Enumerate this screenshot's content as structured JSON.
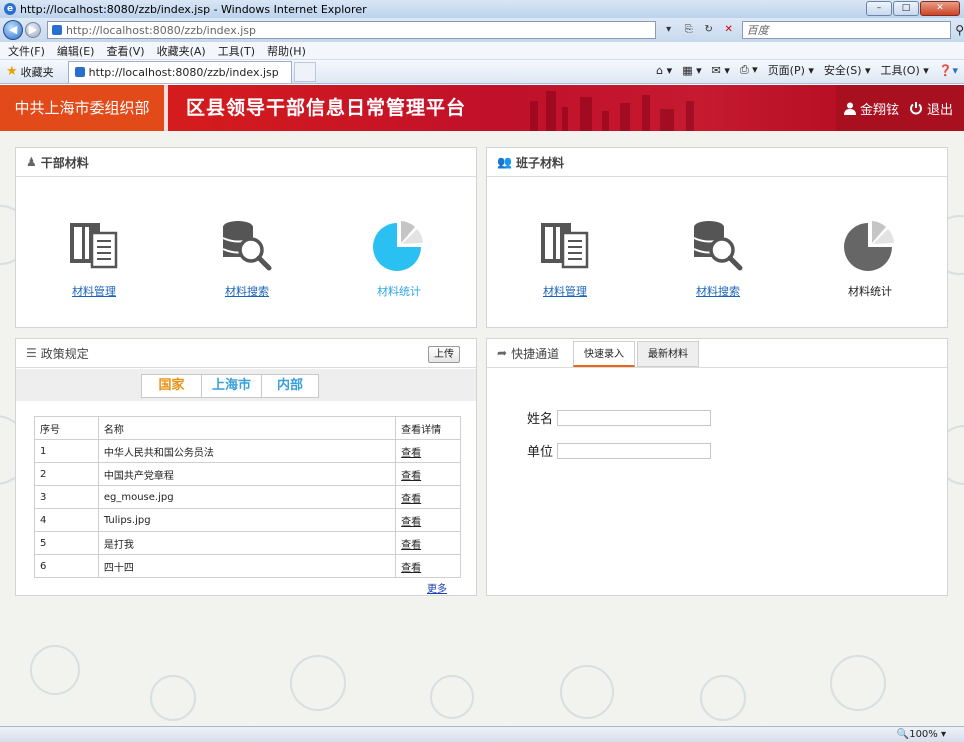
{
  "browser": {
    "window_title": "http://localhost:8080/zzb/index.jsp - Windows Internet Explorer",
    "address": "http://localhost:8080/zzb/index.jsp",
    "search_placeholder": "百度",
    "menu": [
      "文件(F)",
      "编辑(E)",
      "查看(V)",
      "收藏夹(A)",
      "工具(T)",
      "帮助(H)"
    ],
    "favorites_label": "收藏夹",
    "tab_title": "http://localhost:8080/zzb/index.jsp",
    "commands": [
      "页面(P) ▾",
      "安全(S) ▾",
      "工具(O) ▾"
    ],
    "zoom": "100%"
  },
  "header": {
    "org": "中共上海市委组织部",
    "platform": "区县领导干部信息日常管理平台",
    "user": "金翔铉",
    "logout": "退出"
  },
  "cadre_panel": {
    "title": "干部材料",
    "items": [
      {
        "label": "材料管理",
        "icon": "document-stack-icon"
      },
      {
        "label": "材料搜索",
        "icon": "database-search-icon"
      },
      {
        "label": "材料统计",
        "icon": "pie-chart-icon"
      }
    ]
  },
  "team_panel": {
    "title": "班子材料",
    "items": [
      {
        "label": "材料管理",
        "icon": "document-stack-icon"
      },
      {
        "label": "材料搜索",
        "icon": "database-search-icon"
      },
      {
        "label": "材料统计",
        "icon": "pie-chart-icon"
      }
    ]
  },
  "policy_panel": {
    "title": "政策规定",
    "upload": "上传",
    "regions": [
      "国家",
      "上海市",
      "内部"
    ],
    "columns": [
      "序号",
      "名称",
      "查看详情"
    ],
    "rows": [
      {
        "no": "1",
        "name": "中华人民共和国公务员法",
        "action": "查看"
      },
      {
        "no": "2",
        "name": "中国共产党章程",
        "action": "查看"
      },
      {
        "no": "3",
        "name": "eg_mouse.jpg",
        "action": "查看"
      },
      {
        "no": "4",
        "name": "Tulips.jpg",
        "action": "查看"
      },
      {
        "no": "5",
        "name": "是打我",
        "action": "查看"
      },
      {
        "no": "6",
        "name": "四十四",
        "action": "查看"
      }
    ],
    "more": "更多"
  },
  "quick_panel": {
    "title": "快捷通道",
    "tabs": [
      "快速录入",
      "最新材料"
    ],
    "fields": [
      {
        "label": "姓名",
        "value": ""
      },
      {
        "label": "单位",
        "value": ""
      }
    ]
  },
  "colors": {
    "header_red": "#c0102a",
    "org_orange": "#e24a1a",
    "active_tab": "#e89214",
    "link_blue": "#1b63b8",
    "stat_blue": "#2da7e8"
  }
}
